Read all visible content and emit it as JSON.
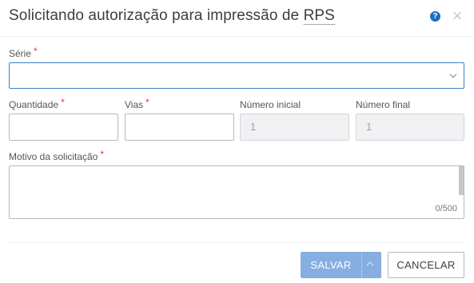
{
  "dialog": {
    "title_prefix": "Solicitando autorização para impressão de ",
    "title_abbr": "RPS",
    "help_icon": "?",
    "close_icon": "×"
  },
  "fields": {
    "serie": {
      "label": "Série",
      "required_mark": "*",
      "value": ""
    },
    "quantidade": {
      "label": "Quantidade",
      "required_mark": "*",
      "value": ""
    },
    "vias": {
      "label": "Vias",
      "required_mark": "*",
      "value": ""
    },
    "numero_inicial": {
      "label": "Número inicial",
      "value": "1"
    },
    "numero_final": {
      "label": "Número final",
      "value": "1"
    },
    "motivo": {
      "label": "Motivo da solicitação",
      "required_mark": "*",
      "value": "",
      "counter": "0/500"
    }
  },
  "buttons": {
    "save_label": "SALVAR",
    "cancel_label": "CANCELAR"
  },
  "colors": {
    "accent": "#1f6fbf",
    "required": "#e0382f",
    "save_button": "#86aee0"
  }
}
